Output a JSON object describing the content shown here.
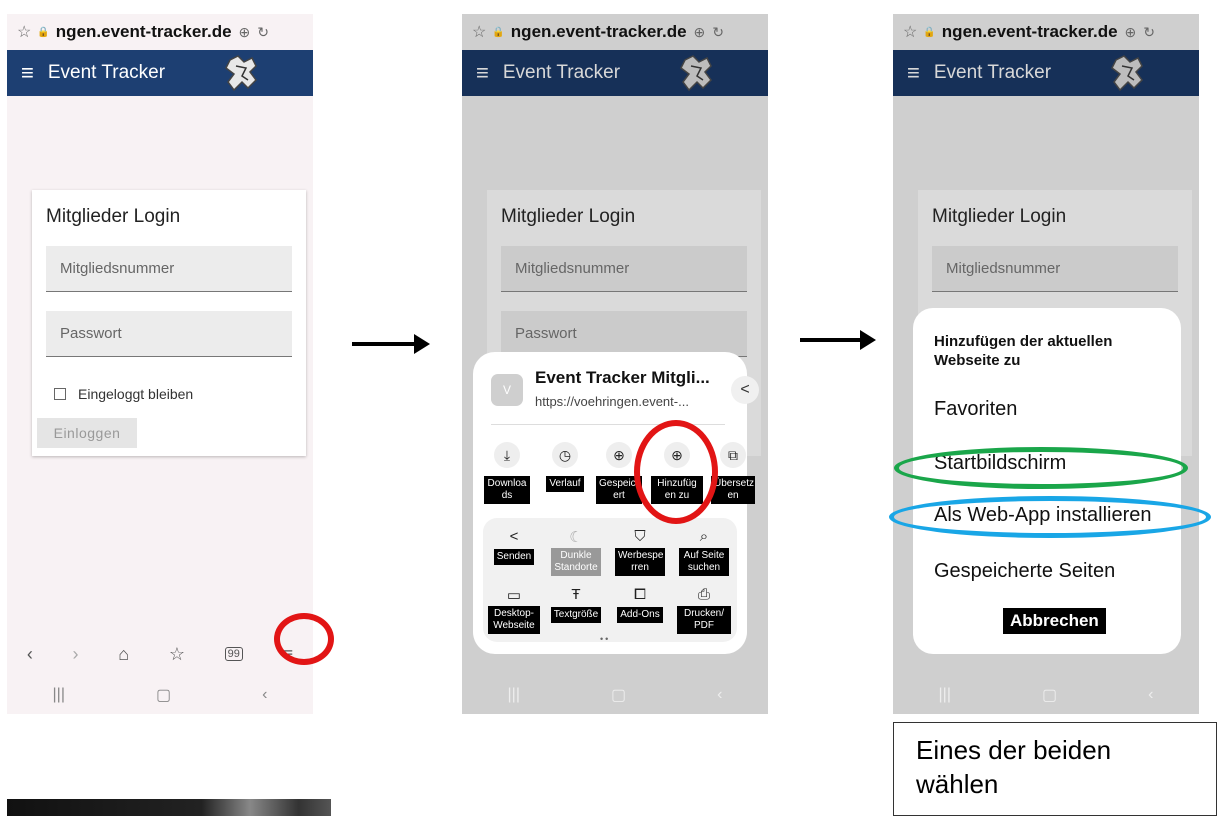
{
  "browser": {
    "url": "ngen.event-tracker.de"
  },
  "app": {
    "title": "Event Tracker"
  },
  "login": {
    "title": "Mitglieder Login",
    "member_placeholder": "Mitgliedsnummer",
    "password_placeholder": "Passwort",
    "remember_label": "Eingeloggt bleiben",
    "submit_label": "Einloggen"
  },
  "menu_sheet": {
    "site_initial": "V",
    "site_title": "Event Tracker Mitgli...",
    "site_url": "https://voehringen.event-...",
    "quick_actions": [
      {
        "icon": "download-icon",
        "glyph": "⤓",
        "label": "Downloa ds"
      },
      {
        "icon": "history-icon",
        "glyph": "◷",
        "label": "Verlauf"
      },
      {
        "icon": "saved-pages-icon",
        "glyph": "⊕",
        "label": "Gespeich ert"
      },
      {
        "icon": "add-icon",
        "glyph": "⊕",
        "label": "Hinzufüg en zu"
      },
      {
        "icon": "translate-icon",
        "glyph": "⧉",
        "label": "Übersetz en"
      }
    ],
    "grid": [
      {
        "icon": "share-icon",
        "glyph": "<",
        "label": "Senden"
      },
      {
        "icon": "moon-icon",
        "glyph": "☾",
        "label": "Dunkle Standorte"
      },
      {
        "icon": "shield-icon",
        "glyph": "⛉",
        "label": "Werbespe rren"
      },
      {
        "icon": "find-in-page-icon",
        "glyph": "⌕",
        "label": "Auf Seite suchen"
      },
      {
        "icon": "desktop-icon",
        "glyph": "▭",
        "label": "Desktop- Webseite"
      },
      {
        "icon": "text-size-icon",
        "glyph": "Ŧ",
        "label": "Textgröße"
      },
      {
        "icon": "addons-icon",
        "glyph": "⧠",
        "label": "Add-Ons"
      },
      {
        "icon": "print-icon",
        "glyph": "⎙",
        "label": "Drucken/ PDF"
      }
    ]
  },
  "add_sheet": {
    "title": "Hinzufügen der aktuellen Webseite zu",
    "options": [
      "Favoriten",
      "Startbildschirm",
      "Als Web-App installieren",
      "Gespeicherte Seiten"
    ],
    "cancel_label": "Abbrechen"
  },
  "note": {
    "text": "Eines der beiden wählen"
  },
  "colors": {
    "appbar": "#1d3f72",
    "highlight_red": "#e21515",
    "highlight_green": "#1aa64a",
    "highlight_blue": "#19a6e6"
  }
}
